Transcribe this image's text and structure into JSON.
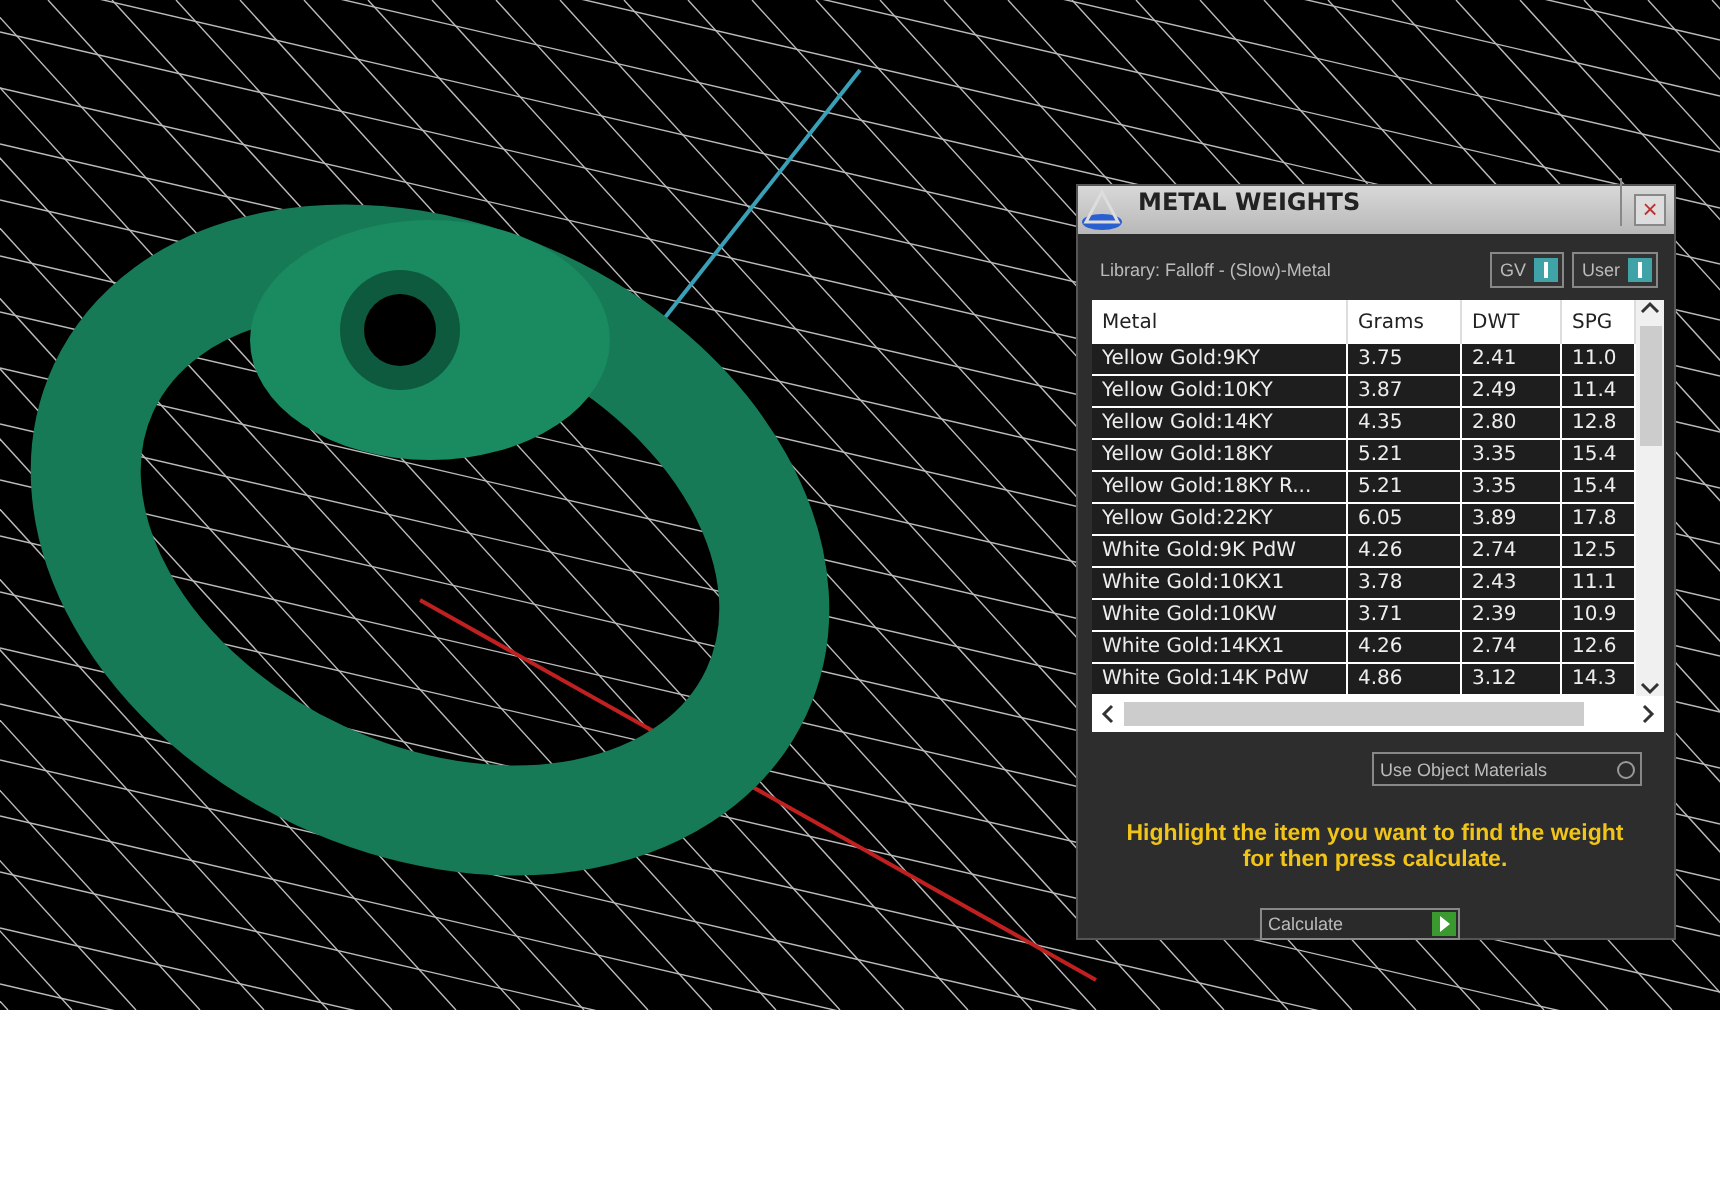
{
  "panel": {
    "title": "METAL WEIGHTS",
    "close": "×",
    "library": "Library: Falloff - (Slow)-Metal",
    "toggles": [
      {
        "label": "GV",
        "on": true
      },
      {
        "label": "User",
        "on": true
      }
    ],
    "table": {
      "columns": [
        "Metal",
        "Grams",
        "DWT",
        "SPG"
      ],
      "rows": [
        {
          "cells": [
            "Yellow Gold:9KY",
            "3.75",
            "2.41",
            "11.0"
          ],
          "selected": false
        },
        {
          "cells": [
            "Yellow Gold:10KY",
            "3.87",
            "2.49",
            "11.4"
          ],
          "selected": false
        },
        {
          "cells": [
            "Yellow Gold:14KY",
            "4.35",
            "2.80",
            "12.8"
          ],
          "selected": false
        },
        {
          "cells": [
            "Yellow Gold:18KY",
            "5.21",
            "3.35",
            "15.4"
          ],
          "selected": false
        },
        {
          "cells": [
            "Yellow Gold:18KY R...",
            "5.21",
            "3.35",
            "15.4"
          ],
          "selected": false
        },
        {
          "cells": [
            "Yellow Gold:22KY",
            "6.05",
            "3.89",
            "17.8"
          ],
          "selected": false
        },
        {
          "cells": [
            "White Gold:9K PdW",
            "4.26",
            "2.74",
            "12.5"
          ],
          "selected": false
        },
        {
          "cells": [
            "White Gold:10KX1",
            "3.78",
            "2.43",
            "11.1"
          ],
          "selected": false
        },
        {
          "cells": [
            "White Gold:10KW",
            "3.71",
            "2.39",
            "10.9"
          ],
          "selected": false
        },
        {
          "cells": [
            "White Gold:14KX1",
            "4.26",
            "2.74",
            "12.6"
          ],
          "selected": false
        },
        {
          "cells": [
            "White Gold:14K PdW",
            "4.86",
            "3.12",
            "14.3"
          ],
          "selected": false
        }
      ]
    },
    "dropdown": "Use Object Materials",
    "hint": "Highlight the item you want to find the weight for then press calculate.",
    "button": "Calculate"
  }
}
